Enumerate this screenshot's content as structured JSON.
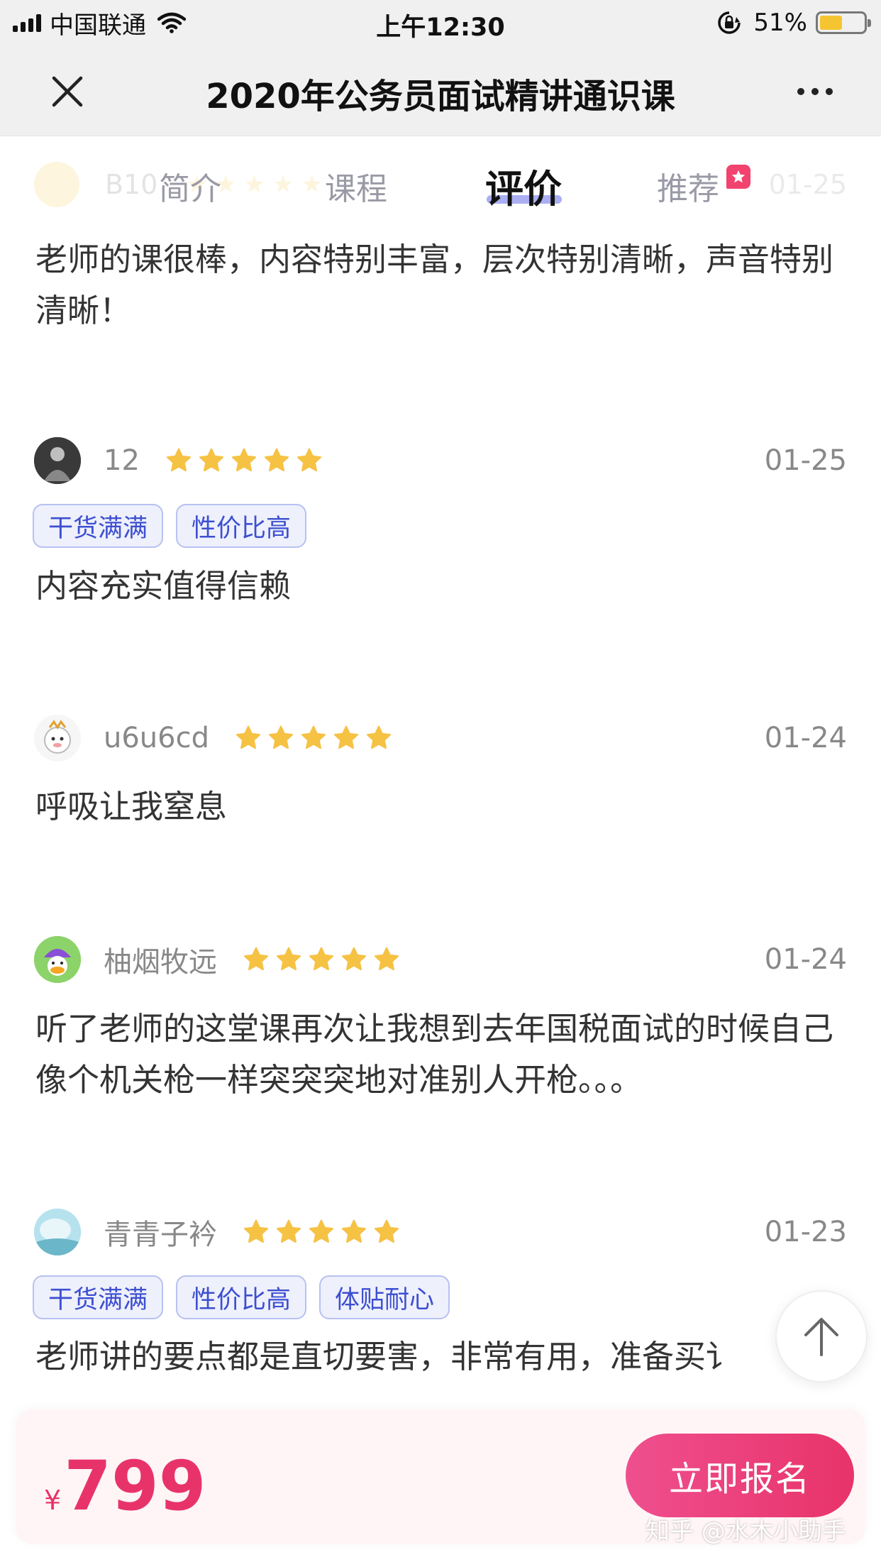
{
  "status_bar": {
    "carrier": "中国联通",
    "time": "上午12:30",
    "battery_percent": "51%",
    "battery_level": 0.51,
    "battery_color": "#f5c531"
  },
  "nav": {
    "title": "2020年公务员面试精讲通识课",
    "close_icon": "close-icon",
    "more_icon": "more-icon"
  },
  "tabs": [
    {
      "label": "简介",
      "active": false
    },
    {
      "label": "课程",
      "active": false
    },
    {
      "label": "评价",
      "active": true
    },
    {
      "label": "推荐",
      "active": false,
      "badge": "star-badge"
    }
  ],
  "faded_review": {
    "username": "B10",
    "date": "01-25"
  },
  "reviews": [
    {
      "text": "老师的课很棒，内容特别丰富，层次特别清晰，声音特别清晰！"
    },
    {
      "username": "12",
      "stars": 5,
      "date": "01-25",
      "tags": [
        "干货满满",
        "性价比高"
      ],
      "text": "内容充实值得信赖"
    },
    {
      "username": "u6u6cd",
      "stars": 5,
      "date": "01-24",
      "tags": [],
      "text": "呼吸让我窒息"
    },
    {
      "username": "柚烟牧远",
      "stars": 5,
      "date": "01-24",
      "tags": [],
      "text": "听了老师的这堂课再次让我想到去年国税面试的时候自己像个机关枪一样突突突地对准别人开枪。。。"
    },
    {
      "username": "青青子衿",
      "stars": 5,
      "date": "01-23",
      "tags": [
        "干货满满",
        "性价比高",
        "体贴耐心"
      ],
      "text": "老师讲的要点都是直切要害，非常有用，准备买讠"
    }
  ],
  "bottom": {
    "currency": "¥",
    "price": "799",
    "enroll_label": "立即报名",
    "price_color": "#e8336a"
  },
  "watermark": "知乎 @水木小助手",
  "colors": {
    "accent": "#e8336a",
    "star": "#f6c244",
    "tag_text": "#3d4fd0"
  }
}
